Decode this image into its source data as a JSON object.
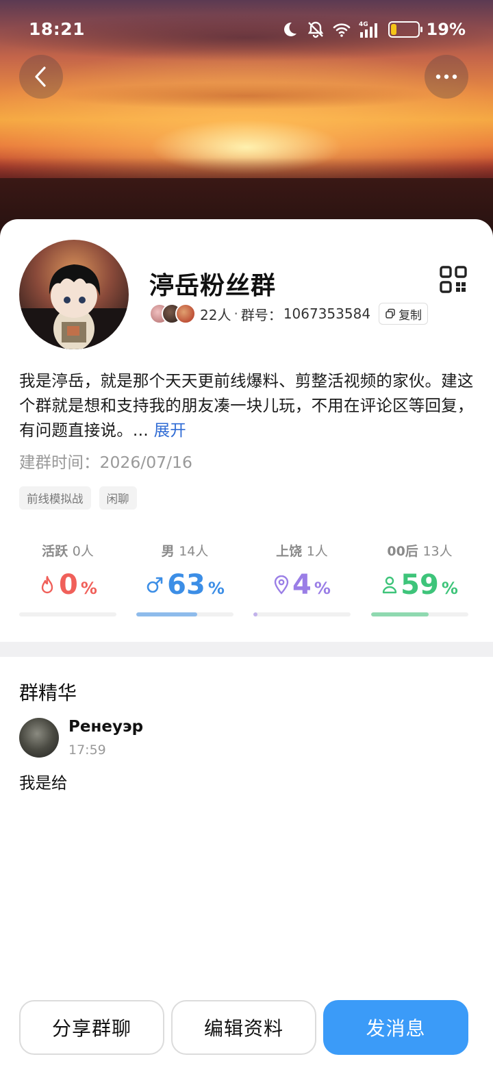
{
  "status_bar": {
    "time": "18:21",
    "battery_percent": "19%",
    "battery_level": 0.19,
    "signal": "4G",
    "wifi_label": "6"
  },
  "header": {
    "back_icon": "chevron-left-icon",
    "more_icon": "more-dots-icon"
  },
  "group": {
    "name": "渟岳粉丝群",
    "member_count": "22人",
    "separator": "·",
    "id_label": "群号：",
    "id_value": "1067353584",
    "copy_label": "复制",
    "intro": "我是渟岳，就是那个天天更前线爆料、剪整活视频的家伙。建这个群就是想和支持我的朋友凑一块儿玩，不用在评论区等回复，有问题直接说。...",
    "expand_label": "展开",
    "created_label": "建群时间：",
    "created_date": "2026/07/16",
    "tags": [
      "前线模拟战",
      "闲聊"
    ]
  },
  "stats": [
    {
      "label": "活跃",
      "count": "0人",
      "percent": "0",
      "unit": "%",
      "value": 0.0,
      "color": "#f0605a",
      "icon": "flame-icon"
    },
    {
      "label": "男",
      "count": "14人",
      "percent": "63",
      "unit": "%",
      "value": 0.63,
      "color": "#3c8ee6",
      "icon": "male-icon"
    },
    {
      "label": "上饶",
      "count": "1人",
      "percent": "4",
      "unit": "%",
      "value": 0.04,
      "color": "#9a7ee6",
      "icon": "location-pin-icon"
    },
    {
      "label": "00后",
      "count": "13人",
      "percent": "59",
      "unit": "%",
      "value": 0.59,
      "color": "#3ec47a",
      "icon": "person-icon"
    }
  ],
  "essence": {
    "title": "群精华",
    "post": {
      "author": "Ренеуэр",
      "time": "17:59",
      "text": "我是给"
    }
  },
  "actions": {
    "share_label": "分享群聊",
    "edit_label": "编辑资料",
    "message_label": "发消息"
  }
}
